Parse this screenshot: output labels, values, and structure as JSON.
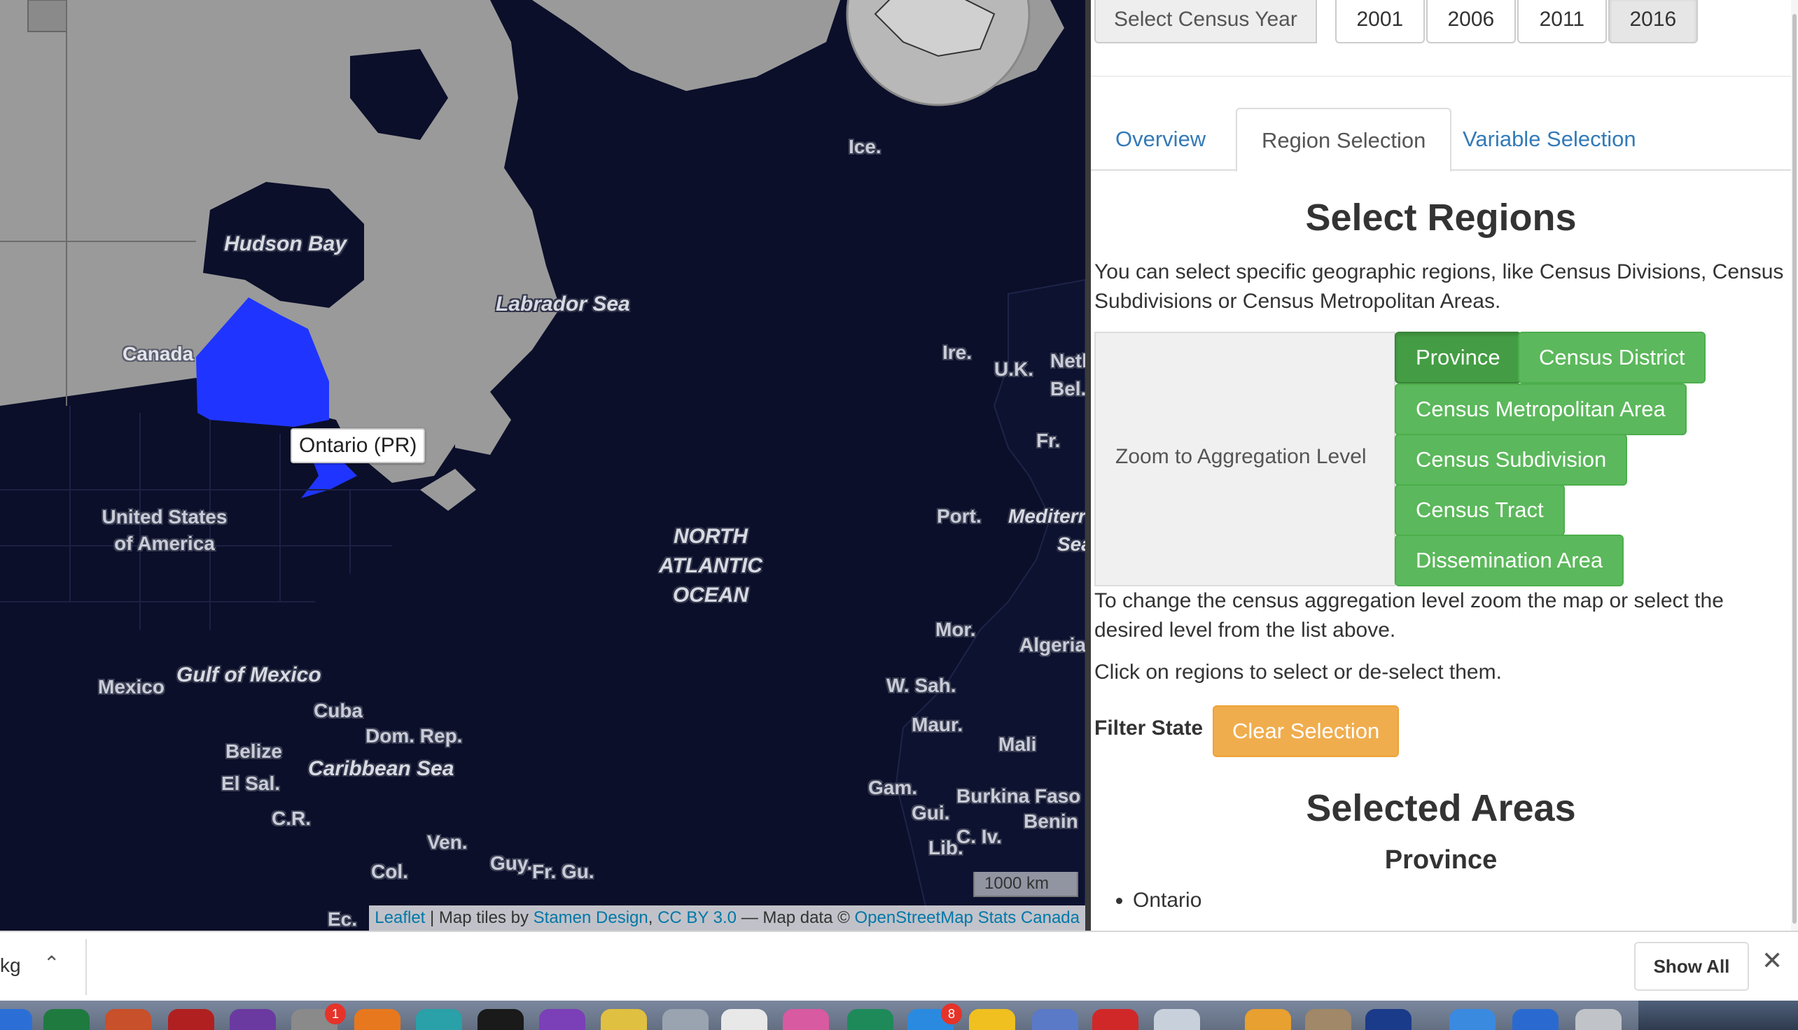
{
  "map": {
    "labels": {
      "hudson_bay": "Hudson Bay",
      "labrador_sea": "Labrador Sea",
      "canada": "Canada",
      "usa": "United States of America",
      "north_atlantic": "NORTH ATLANTIC OCEAN",
      "gulf_of_mexico": "Gulf of Mexico",
      "mexico": "Mexico",
      "cuba": "Cuba",
      "dom_rep": "Dom. Rep.",
      "belize": "Belize",
      "el_sal": "El Sal.",
      "cr": "C.R.",
      "caribbean": "Caribbean Sea",
      "ven": "Ven.",
      "col": "Col.",
      "guy": "Guy.",
      "fr_gu": "Fr. Gu.",
      "ec": "Ec.",
      "ice": "Ice.",
      "ire": "Ire.",
      "uk": "U.K.",
      "neth": "Neth",
      "bel": "Bel.",
      "fr": "Fr.",
      "port": "Port.",
      "mediterr": "Mediterr",
      "sea": "Sea",
      "mor": "Mor.",
      "algeria": "Algeria",
      "w_sah": "W. Sah.",
      "maur": "Maur.",
      "mali": "Mali",
      "gam": "Gam.",
      "burkina": "Burkina Faso",
      "gui": "Gui.",
      "benin": "Benin",
      "lib": "Lib.",
      "civ": "C. Iv."
    },
    "tooltip": "Ontario (PR)",
    "scale": "1000 km",
    "attribution": {
      "leaflet": "Leaflet",
      "sep1": " | Map tiles by ",
      "stamen": "Stamen Design",
      "comma": ", ",
      "cc": "CC BY 3.0",
      "sep2": " — Map data © ",
      "osm": "OpenStreetMap",
      "space": " ",
      "stats": "Stats Canada"
    },
    "colors": {
      "ocean": "#0b0f2a",
      "land": "#9a9a9a",
      "highlight": "#1f35ff"
    }
  },
  "panel": {
    "year_label": "Select Census Year",
    "years": [
      "2001",
      "2006",
      "2011",
      "2016"
    ],
    "active_year": "2016",
    "tabs": [
      "Overview",
      "Region Selection",
      "Variable Selection"
    ],
    "active_tab": "Region Selection",
    "heading": "Select Regions",
    "intro": "You can select specific geographic regions, like Census Divisions, Census Subdivisions or Census Metropolitan Areas.",
    "zoom_label": "Zoom to Aggregation Level",
    "levels": [
      "Province",
      "Census District",
      "Census Metropolitan Area",
      "Census Subdivision",
      "Census Tract",
      "Dissemination Area"
    ],
    "active_level": "Province",
    "help1": "To change the census aggregation level zoom the map or select the desired level from the list above.",
    "help2": "Click on regions to select or de-select them.",
    "filter_label": "Filter State",
    "clear_label": "Clear Selection",
    "selected_heading": "Selected Areas",
    "selected_level": "Province",
    "selected_items": [
      "Ontario"
    ]
  },
  "downloads": {
    "file_fragment": "kg",
    "show_all": "Show All"
  },
  "dock": {
    "badges": {
      "settings": "1",
      "appstore": "8"
    }
  }
}
